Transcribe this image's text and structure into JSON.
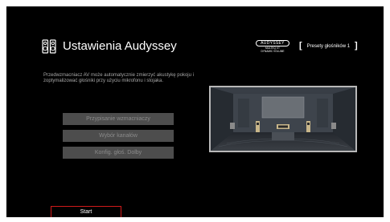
{
  "header": {
    "title": "Ustawienia Audyssey",
    "icon": "speaker-setup-icon"
  },
  "audyssey_logo": {
    "brand": "AUDYSSEY",
    "sub_line_1": "MULTEQ XT",
    "sub_line_2": "DYNAMIC VOLUME"
  },
  "preset": {
    "open_bracket": "[",
    "label": "Presety głośników 1",
    "close_bracket": "]"
  },
  "description": "Przedwzmacniacz AV może automatycznie zmierzyć akustykę pokoju i zoptymalizować głośniki przy użyciu mikrofonu i stojaka.",
  "menu": {
    "items": [
      {
        "label": "Przypisanie wzmacniaczy"
      },
      {
        "label": "Wybór kanałów"
      },
      {
        "label": "Konfig. głoś. Dolby"
      }
    ]
  },
  "start_label": "Start",
  "colors": {
    "background": "#000000",
    "button_bg": "#4d4d4d",
    "button_text": "#8a8a8a",
    "start_border": "#d01a1a",
    "description_text": "#a8a8a8"
  }
}
